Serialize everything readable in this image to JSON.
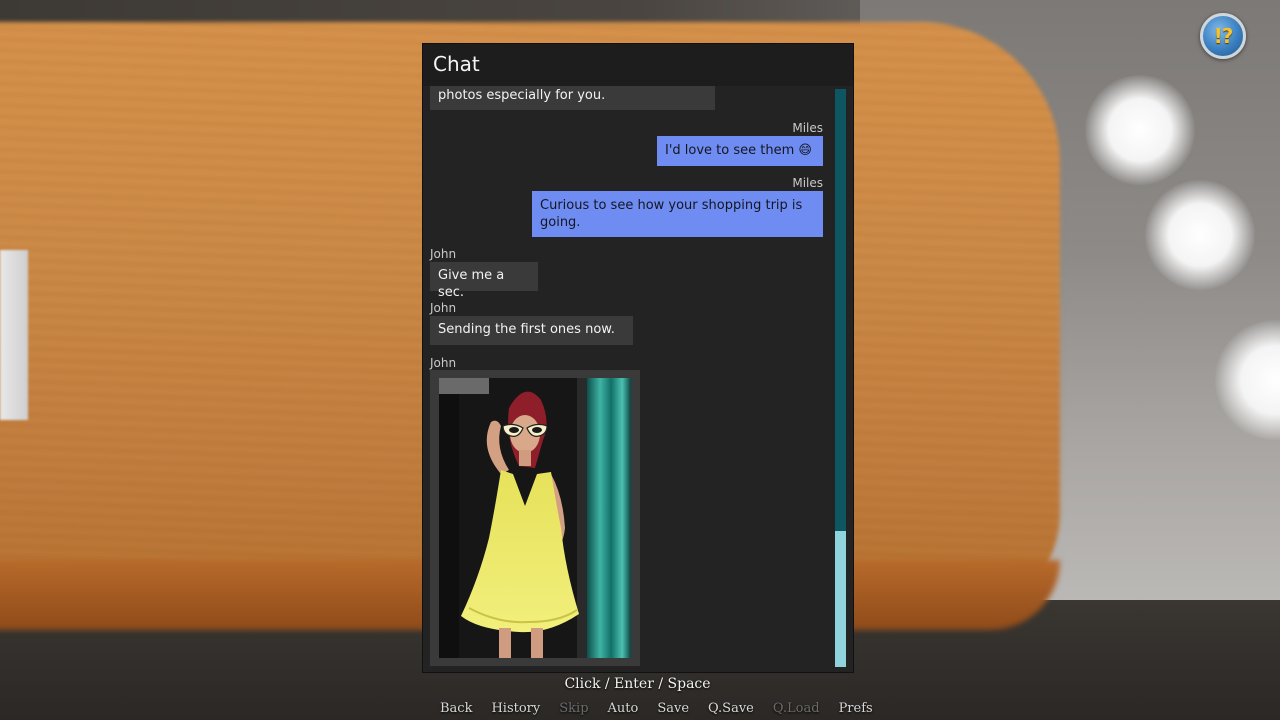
{
  "chat": {
    "title": "Chat",
    "messages": [
      {
        "sender": "",
        "text": "photos especially for you.",
        "direction": "in"
      },
      {
        "sender": "Miles",
        "text": "I'd love to see them 😄",
        "direction": "out"
      },
      {
        "sender": "Miles",
        "text": "Curious to see how your shopping trip is going.",
        "direction": "out"
      },
      {
        "sender": "John",
        "text": "Give me a sec.",
        "direction": "in"
      },
      {
        "sender": "John",
        "text": "Sending the first ones now.",
        "direction": "in"
      },
      {
        "sender": "John",
        "text": "",
        "direction": "in",
        "attachment": "photo"
      }
    ]
  },
  "hint": "Click / Enter / Space",
  "quick_menu": [
    {
      "label": "Back",
      "enabled": true
    },
    {
      "label": "History",
      "enabled": true
    },
    {
      "label": "Skip",
      "enabled": false
    },
    {
      "label": "Auto",
      "enabled": true
    },
    {
      "label": "Save",
      "enabled": true
    },
    {
      "label": "Q.Save",
      "enabled": true
    },
    {
      "label": "Q.Load",
      "enabled": false
    },
    {
      "label": "Prefs",
      "enabled": true
    }
  ],
  "help_badge": {
    "symbol": "!?",
    "icon": "help-badge-icon"
  },
  "colors": {
    "outgoing_bubble": "#6f8cf3",
    "incoming_bubble": "#3a3a3a",
    "scrollbar_track": "#0e5661",
    "scrollbar_thumb": "#8fd3dc"
  },
  "scroll_position": 0.77
}
